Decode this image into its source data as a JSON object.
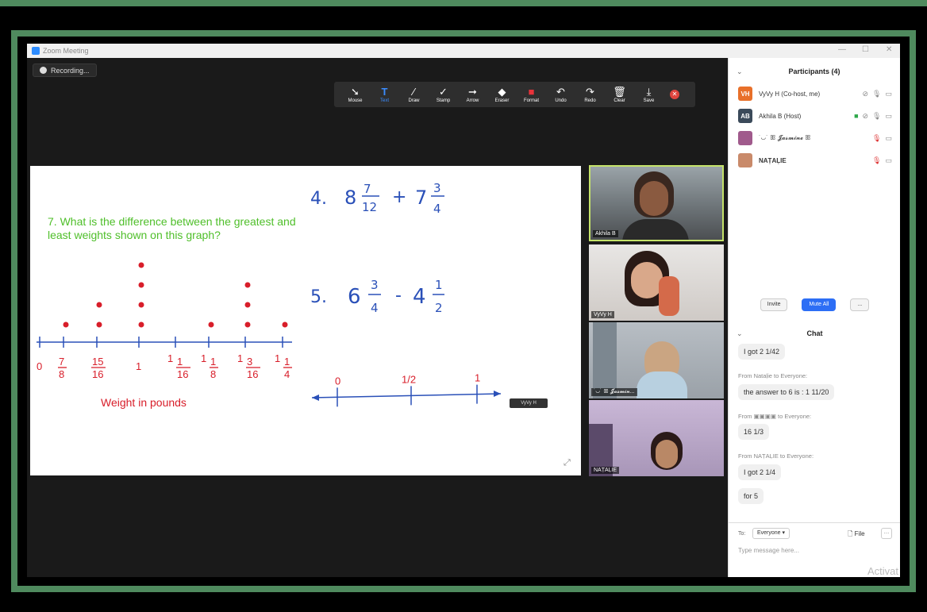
{
  "window": {
    "title": "Zoom Meeting"
  },
  "recording": {
    "label": "Recording..."
  },
  "toolbar": {
    "tools": [
      {
        "label": "Mouse",
        "icon": "mouse-pointer-icon"
      },
      {
        "label": "Text",
        "icon": "text-icon"
      },
      {
        "label": "Draw",
        "icon": "draw-icon"
      },
      {
        "label": "Stamp",
        "icon": "stamp-icon"
      },
      {
        "label": "Arrow",
        "icon": "arrow-icon"
      },
      {
        "label": "Eraser",
        "icon": "eraser-icon"
      },
      {
        "label": "Format",
        "icon": "format-icon"
      },
      {
        "label": "Undo",
        "icon": "undo-icon"
      },
      {
        "label": "Redo",
        "icon": "redo-icon"
      },
      {
        "label": "Clear",
        "icon": "trash-icon"
      },
      {
        "label": "Save",
        "icon": "save-icon"
      }
    ],
    "active_tool": "Text"
  },
  "whiteboard": {
    "question": "7. What is the difference between the greatest and least weights shown on this graph?",
    "axis_label": "Weight in pounds",
    "problem4": {
      "num": "4.",
      "w1": "8",
      "n1": "7",
      "d1": "12",
      "op": "+",
      "w2": "7",
      "n2": "3",
      "d2": "4"
    },
    "problem5": {
      "num": "5.",
      "w1": "6",
      "n1": "3",
      "d1": "4",
      "op": "-",
      "w2": "4",
      "n2": "1",
      "d2": "2"
    },
    "lineplot_ticks": [
      {
        "whole": "0",
        "num": "",
        "den": ""
      },
      {
        "whole": "",
        "num": "7",
        "den": "8"
      },
      {
        "whole": "",
        "num": "15",
        "den": "16"
      },
      {
        "whole": "1",
        "num": "",
        "den": ""
      },
      {
        "whole": "1",
        "num": "1",
        "den": "16"
      },
      {
        "whole": "1",
        "num": "1",
        "den": "8"
      },
      {
        "whole": "1",
        "num": "3",
        "den": "16"
      },
      {
        "whole": "1",
        "num": "1",
        "den": "4"
      }
    ],
    "dot_counts": [
      0,
      1,
      2,
      4,
      0,
      1,
      3,
      1
    ],
    "numberline_labels": [
      "0",
      "1/2",
      "1"
    ],
    "annotator_tag": "VyVy H"
  },
  "videos": [
    {
      "name": "Akhila B"
    },
    {
      "name": "VyVy H"
    },
    {
      "name": "˙◡˙ ꕥ 𝓙𝓪𝓼𝓶𝓲𝓷..."
    },
    {
      "name": "NAṬAḶIE"
    }
  ],
  "participants": {
    "header": "Participants (4)",
    "list": [
      {
        "initials": "VH",
        "name": "VyVy H (Co-host, me)",
        "color": "#e8702a"
      },
      {
        "initials": "AB",
        "name": "Akhila B (Host)",
        "color": "#3b4a5a"
      },
      {
        "initials": "",
        "name": "˙◡˙ ꕥ 𝓙𝓪𝓼𝓶𝓲𝓷𝓮 ꕥ",
        "color": "#a05a8c"
      },
      {
        "initials": "",
        "name": "NAṬAḶIE",
        "color": "#c98a6a"
      }
    ],
    "invite": "Invite",
    "mute_all": "Mute All",
    "more": "..."
  },
  "chat": {
    "header": "Chat",
    "messages": [
      {
        "from": "",
        "text": "I got 2 1/42"
      },
      {
        "from": "From Nataḷie to Everyone:",
        "sender": "Nataḷie",
        "text": "the answer to 6 is : 1 11/20"
      },
      {
        "from": "From ▣▣▣▣ to Everyone:",
        "sender": "▣▣▣▣",
        "text": "16 1/3"
      },
      {
        "from": "From NAṬAḶIE to Everyone:",
        "sender": "NAṬAḶIE",
        "text": "I got 2 1/4"
      },
      {
        "from": "",
        "text": "for 5"
      }
    ],
    "to_label": "To:",
    "to_value": "Everyone ▾",
    "file": "File",
    "placeholder": "Type message here...",
    "watermark": "Activat"
  }
}
